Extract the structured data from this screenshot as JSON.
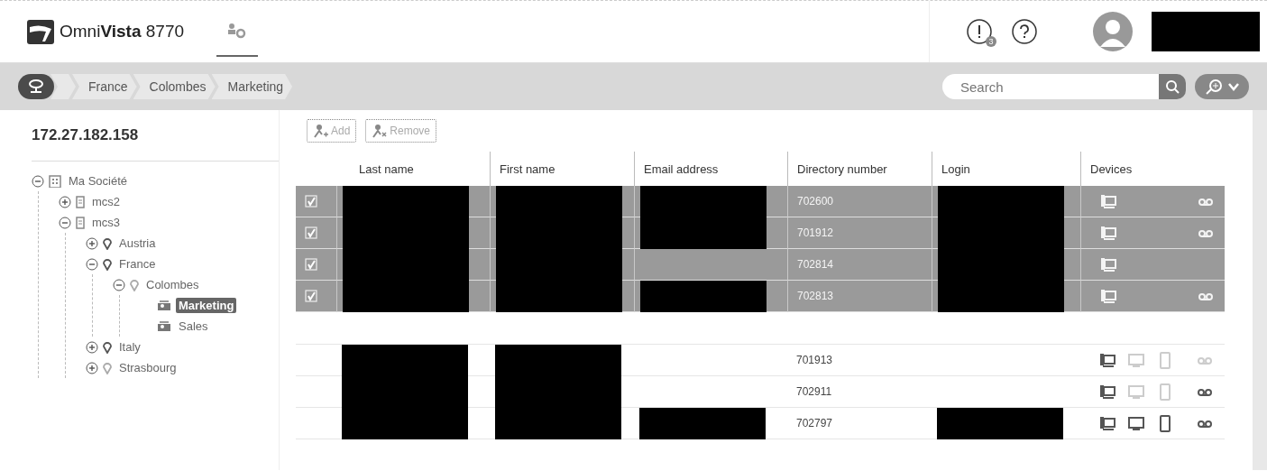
{
  "app": {
    "brand_light": "Omni",
    "brand_bold": "Vista",
    "brand_version": "8770",
    "alert_count": "3"
  },
  "breadcrumb": [
    "France",
    "Colombes",
    "Marketing"
  ],
  "search": {
    "placeholder": "Search"
  },
  "sidebar": {
    "server": "172.27.182.158",
    "tree": [
      {
        "label": "Ma Société",
        "kind": "company",
        "expanded": true,
        "selected": false,
        "children": [
          {
            "label": "mcs2",
            "kind": "server",
            "expanded": false,
            "selected": false
          },
          {
            "label": "mcs3",
            "kind": "server",
            "expanded": true,
            "selected": false,
            "children": [
              {
                "label": "Austria",
                "kind": "country",
                "expanded": false,
                "selected": false
              },
              {
                "label": "France",
                "kind": "country",
                "expanded": true,
                "selected": false,
                "children": [
                  {
                    "label": "Colombes",
                    "kind": "city",
                    "expanded": true,
                    "selected": false,
                    "children": [
                      {
                        "label": "Marketing",
                        "kind": "department",
                        "selected": true
                      },
                      {
                        "label": "Sales",
                        "kind": "department",
                        "selected": false
                      }
                    ]
                  }
                ]
              },
              {
                "label": "Italy",
                "kind": "country",
                "expanded": false,
                "selected": false
              },
              {
                "label": "Strasbourg",
                "kind": "city",
                "expanded": false,
                "selected": false
              }
            ]
          }
        ]
      }
    ]
  },
  "toolbar": [
    {
      "label": "Add",
      "kind": "add"
    },
    {
      "label": "Remove",
      "kind": "remove"
    }
  ],
  "table": {
    "columns": [
      "Last name",
      "First name",
      "Email address",
      "Directory number",
      "Login",
      "Devices"
    ],
    "rows": [
      {
        "selected": true,
        "number": "702600",
        "last_name_redacted": true,
        "first_name_redacted": true,
        "email_redacted": true,
        "login_redacted": true,
        "devices": [
          {
            "kind": "deskphone",
            "enabled": true
          },
          {
            "kind": "voicemail",
            "enabled": true
          }
        ]
      },
      {
        "selected": true,
        "number": "701912",
        "last_name_redacted": true,
        "first_name_redacted": true,
        "email_redacted": true,
        "login_redacted": true,
        "devices": [
          {
            "kind": "deskphone",
            "enabled": true
          },
          {
            "kind": "voicemail",
            "enabled": true
          }
        ]
      },
      {
        "selected": true,
        "number": "702814",
        "last_name_redacted": true,
        "first_name_redacted": true,
        "email_redacted": false,
        "login_redacted": true,
        "devices": [
          {
            "kind": "deskphone",
            "enabled": true
          }
        ]
      },
      {
        "selected": true,
        "number": "702813",
        "last_name_redacted": true,
        "first_name_redacted": true,
        "email_redacted": true,
        "login_redacted": true,
        "devices": [
          {
            "kind": "deskphone",
            "enabled": true
          },
          {
            "kind": "voicemail",
            "enabled": true
          }
        ]
      },
      {
        "selected": false,
        "number": "701913",
        "last_name_redacted": true,
        "first_name_redacted": true,
        "email_redacted": false,
        "login_redacted": false,
        "devices": [
          {
            "kind": "deskphone",
            "enabled": true
          },
          {
            "kind": "softphone",
            "enabled": false
          },
          {
            "kind": "mobile",
            "enabled": false
          },
          {
            "kind": "voicemail",
            "enabled": false
          }
        ]
      },
      {
        "selected": false,
        "number": "702911",
        "last_name_redacted": true,
        "first_name_redacted": true,
        "email_redacted": false,
        "login_redacted": false,
        "devices": [
          {
            "kind": "deskphone",
            "enabled": true
          },
          {
            "kind": "softphone",
            "enabled": false
          },
          {
            "kind": "mobile",
            "enabled": false
          },
          {
            "kind": "voicemail",
            "enabled": true
          }
        ]
      },
      {
        "selected": false,
        "number": "702797",
        "last_name_redacted": true,
        "first_name_redacted": true,
        "email_redacted": true,
        "login_redacted": true,
        "devices": [
          {
            "kind": "deskphone",
            "enabled": true
          },
          {
            "kind": "softphone",
            "enabled": true
          },
          {
            "kind": "mobile",
            "enabled": true
          },
          {
            "kind": "voicemail",
            "enabled": true
          }
        ]
      }
    ]
  }
}
